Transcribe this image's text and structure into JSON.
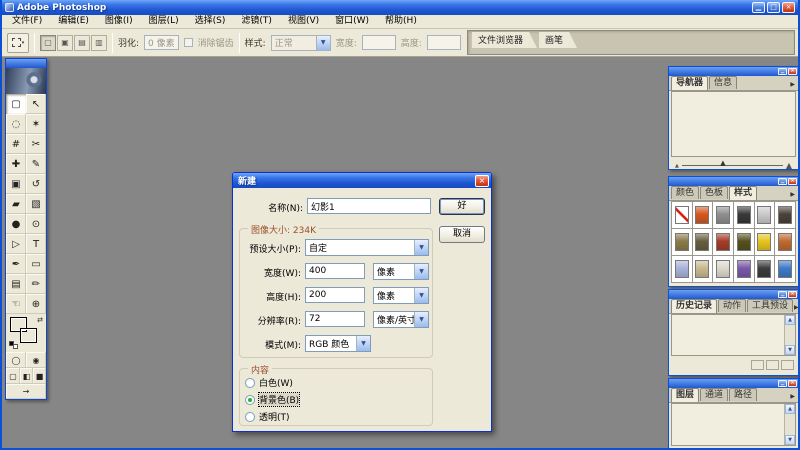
{
  "window": {
    "title": "Adobe Photoshop",
    "minimize_glyph": "▁",
    "restore_glyph": "□",
    "close_glyph": "×"
  },
  "menu": {
    "items": [
      {
        "label": "文件(F)"
      },
      {
        "label": "编辑(E)"
      },
      {
        "label": "图像(I)"
      },
      {
        "label": "图层(L)"
      },
      {
        "label": "选择(S)"
      },
      {
        "label": "滤镜(T)"
      },
      {
        "label": "视图(V)"
      },
      {
        "label": "窗口(W)"
      },
      {
        "label": "帮助(H)"
      }
    ]
  },
  "options_bar": {
    "selection_modes": [
      {
        "name": "new-selection-button",
        "glyph": "▢",
        "cls": "pressed"
      },
      {
        "name": "add-to-selection-button",
        "glyph": "▣"
      },
      {
        "name": "subtract-from-selection-button",
        "glyph": "▤"
      },
      {
        "name": "intersect-selection-button",
        "glyph": "▥"
      }
    ],
    "feather_label": "羽化:",
    "feather_value": "0 像素",
    "antialias_label": "消除锯齿",
    "style_label": "样式:",
    "style_value": "正常",
    "width_label": "宽度:",
    "height_label": "高度:",
    "well_tabs": [
      {
        "label": "文件浏览器"
      },
      {
        "label": "画笔"
      }
    ]
  },
  "toolbox": {
    "tools": [
      {
        "name": "rectangular-marquee-tool",
        "glyph": "▢",
        "cls": "selected"
      },
      {
        "name": "move-tool",
        "glyph": "↖"
      },
      {
        "name": "lasso-tool",
        "glyph": "◌"
      },
      {
        "name": "magic-wand-tool",
        "glyph": "✶"
      },
      {
        "name": "crop-tool",
        "glyph": "#"
      },
      {
        "name": "slice-tool",
        "glyph": "✂"
      },
      {
        "name": "healing-brush-tool",
        "glyph": "✚"
      },
      {
        "name": "brush-tool",
        "glyph": "✎"
      },
      {
        "name": "clone-stamp-tool",
        "glyph": "▣"
      },
      {
        "name": "history-brush-tool",
        "glyph": "↺"
      },
      {
        "name": "eraser-tool",
        "glyph": "▰"
      },
      {
        "name": "gradient-tool",
        "glyph": "▧"
      },
      {
        "name": "blur-tool",
        "glyph": "●"
      },
      {
        "name": "dodge-tool",
        "glyph": "⊙"
      },
      {
        "name": "path-selection-tool",
        "glyph": "▷"
      },
      {
        "name": "type-tool",
        "glyph": "T"
      },
      {
        "name": "pen-tool",
        "glyph": "✒"
      },
      {
        "name": "rectangle-tool",
        "glyph": "▭"
      },
      {
        "name": "notes-tool",
        "glyph": "▤"
      },
      {
        "name": "eyedropper-tool",
        "glyph": "✏"
      },
      {
        "name": "hand-tool",
        "glyph": "☜"
      },
      {
        "name": "zoom-tool",
        "glyph": "⊕"
      }
    ],
    "foreground_color": "#ffffff",
    "background_color": "#000000",
    "swap_colors_glyph": "⇄",
    "mask_buttons": [
      {
        "name": "standard-mode-button",
        "glyph": "◯"
      },
      {
        "name": "quick-mask-mode-button",
        "glyph": "◉"
      }
    ],
    "screen_buttons": [
      {
        "name": "standard-screen-mode-button",
        "glyph": "▢"
      },
      {
        "name": "fullscreen-with-menu-button",
        "glyph": "◧"
      },
      {
        "name": "fullscreen-mode-button",
        "glyph": "■"
      }
    ],
    "imageready_glyph": "→"
  },
  "palettes": {
    "flyout_glyph": "▶",
    "scroll_up_glyph": "▲",
    "scroll_down_glyph": "▼",
    "navigator": {
      "tabs": [
        {
          "label": "导航器",
          "cls": "active"
        },
        {
          "label": "信息"
        }
      ],
      "zoom_out_glyph": "▲",
      "zoom_in_glyph": "▲",
      "thumb_glyph": "▲"
    },
    "styles": {
      "tabs": [
        {
          "label": "颜色"
        },
        {
          "label": "色板"
        },
        {
          "label": "样式",
          "cls": "active"
        }
      ],
      "swatches": [
        {
          "color": "#ffffff",
          "cls": "nostyle",
          "name": "no-style-swatch"
        },
        {
          "color": "#d4581e"
        },
        {
          "color": "#8f8f8f"
        },
        {
          "color": "#383838"
        },
        {
          "color": "#c9c9c9"
        },
        {
          "color": "#4a423a"
        },
        {
          "color": "#8a7a4a"
        },
        {
          "color": "#665e3e"
        },
        {
          "color": "#a53c28"
        },
        {
          "color": "#56511f"
        },
        {
          "color": "#e6c41f"
        },
        {
          "color": "#bf6a2e"
        },
        {
          "color": "#a9b2da"
        },
        {
          "color": "#c9b98e"
        },
        {
          "color": "#dcd8cb"
        },
        {
          "color": "#7a58a8"
        },
        {
          "color": "#3c3c3c"
        },
        {
          "color": "#3d7ac9"
        }
      ]
    },
    "history": {
      "tabs": [
        {
          "label": "历史记录",
          "cls": "active"
        },
        {
          "label": "动作"
        },
        {
          "label": "工具预设"
        }
      ]
    },
    "layers": {
      "tabs": [
        {
          "label": "图层",
          "cls": "active"
        },
        {
          "label": "通道"
        },
        {
          "label": "路径"
        }
      ]
    }
  },
  "dialog": {
    "title": "新建",
    "close_glyph": "×",
    "name_label": "名称(N):",
    "name_value": "幻影1",
    "ok_label": "好",
    "cancel_label": "取消",
    "image_size_caption": "图像大小: 234K",
    "preset_label": "预设大小(P):",
    "preset_value": "自定",
    "width_label": "宽度(W):",
    "width_value": "400",
    "width_unit": "像素",
    "height_label": "高度(H):",
    "height_value": "200",
    "height_unit": "像素",
    "resolution_label": "分辨率(R):",
    "resolution_value": "72",
    "resolution_unit": "像素/英寸",
    "mode_label": "模式(M):",
    "mode_value": "RGB 颜色",
    "contents_caption": "内容",
    "radios": [
      {
        "label": "白色(W)",
        "name": "contents-white-radio"
      },
      {
        "label": "背景色(B)",
        "name": "contents-background-color-radio",
        "cls": "checked",
        "lcls": "focused"
      },
      {
        "label": "透明(T)",
        "name": "contents-transparent-radio"
      }
    ],
    "dropdown_glyph": "▼"
  }
}
